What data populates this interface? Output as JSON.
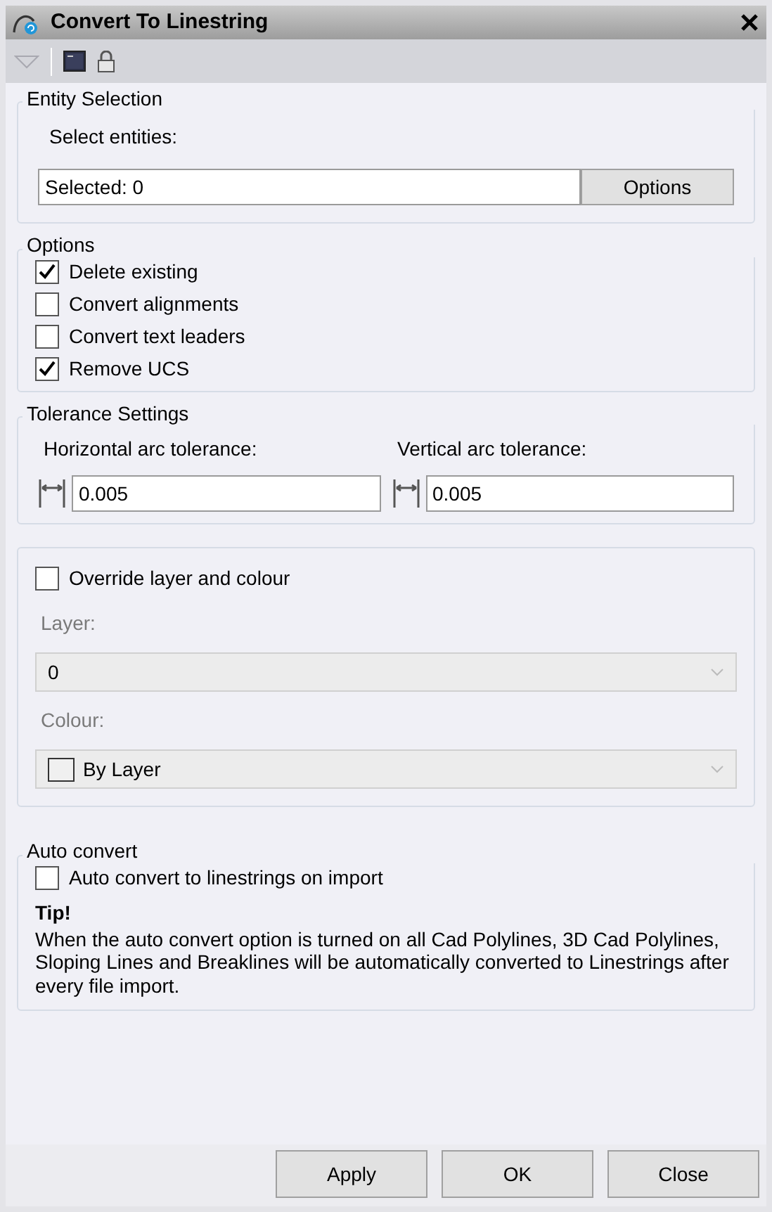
{
  "window": {
    "title": "Convert To Linestring"
  },
  "entity_selection": {
    "legend": "Entity Selection",
    "label": "Select entities:",
    "value": "Selected: 0",
    "button": "Options"
  },
  "options": {
    "legend": "Options",
    "items": [
      {
        "label": "Delete existing",
        "checked": true
      },
      {
        "label": "Convert alignments",
        "checked": false
      },
      {
        "label": "Convert text leaders",
        "checked": false
      },
      {
        "label": "Remove UCS",
        "checked": true
      }
    ]
  },
  "tolerance": {
    "legend": "Tolerance Settings",
    "fields": [
      {
        "label": "Horizontal arc tolerance:",
        "value": "0.005"
      },
      {
        "label": "Vertical arc tolerance:",
        "value": "0.005"
      }
    ]
  },
  "override": {
    "checkbox": {
      "label": "Override layer and colour",
      "checked": false
    },
    "selects": [
      {
        "kind": "layer",
        "label": "Layer:",
        "value": "0",
        "disabled": true
      },
      {
        "kind": "colour",
        "label": "Colour:",
        "value": "By Layer",
        "disabled": true
      }
    ]
  },
  "auto_convert": {
    "legend": "Auto convert",
    "checkbox": {
      "label": "Auto convert to linestrings on import",
      "checked": false
    },
    "tip_title": "Tip!",
    "tip_text": "When the auto convert option is turned on all Cad Polylines, 3D Cad Polylines, Sloping Lines and Breaklines will be automatically converted to Linestrings after every file import."
  },
  "buttons": [
    "Apply",
    "OK",
    "Close"
  ]
}
